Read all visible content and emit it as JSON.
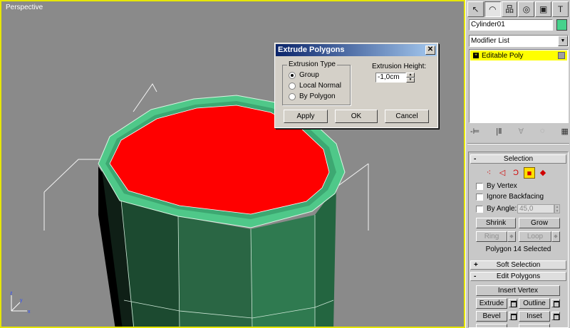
{
  "viewport": {
    "label": "Perspective"
  },
  "dialog": {
    "title": "Extrude Polygons",
    "close_glyph": "✕",
    "extrusion_type_label": "Extrusion Type",
    "options": [
      {
        "label": "Group",
        "selected": true
      },
      {
        "label": "Local Normal",
        "selected": false
      },
      {
        "label": "By Polygon",
        "selected": false
      }
    ],
    "height_label": "Extrusion Height:",
    "height_value": "-1,0cm",
    "buttons": {
      "apply": "Apply",
      "ok": "OK",
      "cancel": "Cancel"
    }
  },
  "panel": {
    "tabs": [
      {
        "icon": "create-icon",
        "glyph": "↖"
      },
      {
        "icon": "modify-icon",
        "glyph": "◠"
      },
      {
        "icon": "hierarchy-icon",
        "glyph": "品"
      },
      {
        "icon": "motion-icon",
        "glyph": "◎"
      },
      {
        "icon": "display-icon",
        "glyph": "▣"
      },
      {
        "icon": "utilities-icon",
        "glyph": "T"
      }
    ],
    "object_name": "Cylinder01",
    "object_color": "#46d28c",
    "modifier_list": "Modifier List",
    "stack_item": "Editable Poly",
    "stack_tools": [
      "-⊨",
      "|Ⅱ",
      "∀",
      "◌",
      "▦"
    ]
  },
  "selection": {
    "title": "Selection",
    "sub_objects": [
      {
        "icon": "vertex-icon",
        "glyph": "⁖",
        "active": false
      },
      {
        "icon": "edge-icon",
        "glyph": "◁",
        "active": false
      },
      {
        "icon": "border-icon",
        "glyph": "Ɔ",
        "active": false
      },
      {
        "icon": "polygon-icon",
        "glyph": "■",
        "active": true
      },
      {
        "icon": "element-icon",
        "glyph": "◆",
        "active": false
      }
    ],
    "by_vertex": "By Vertex",
    "ignore_backfacing": "Ignore Backfacing",
    "by_angle": "By Angle:",
    "angle_value": "45,0",
    "shrink": "Shrink",
    "grow": "Grow",
    "ring": "Ring",
    "loop": "Loop",
    "status": "Polygon 14 Selected"
  },
  "soft_selection": {
    "title": "Soft Selection",
    "sign": "+"
  },
  "edit_polygons": {
    "title": "Edit Polygons",
    "sign": "-",
    "insert_vertex": "Insert Vertex",
    "extrude": "Extrude",
    "outline": "Outline",
    "bevel": "Bevel",
    "inset": "Inset"
  },
  "colors": {
    "viewport_bg": "#8a8a8a",
    "active_border": "#e6e600",
    "polygon_selected": "#ff0000",
    "mesh_side": "#2e7a4e",
    "mesh_rim": "#4fc889"
  }
}
